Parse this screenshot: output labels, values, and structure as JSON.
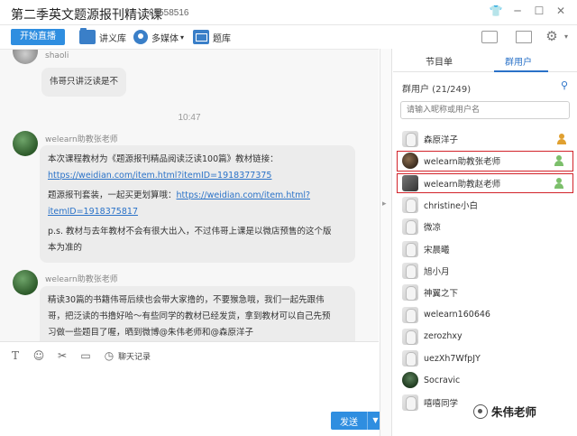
{
  "window": {
    "title": "第二季英文题源报刊精读课",
    "room_id": "81558516",
    "icons": {
      "skin": "shirt-icon",
      "minimize": "minimize-icon",
      "maximize": "maximize-icon",
      "close": "close-icon"
    }
  },
  "toolbar": {
    "live_label": "开始直播",
    "lectures_label": "讲义库",
    "media_label": "多媒体",
    "bank_label": "题库",
    "icons": [
      "briefcase-icon",
      "folder-icon",
      "settings-icon"
    ]
  },
  "chat": {
    "top_sender": "shaoli",
    "top_message": "伟哥只讲泛读是不",
    "timestamp": "10:47",
    "msg1": {
      "sender": "welearn助教张老师",
      "line1": "本次课程教材为《题源报刊精品阅读泛读100篇》教材链接：",
      "link1": "https://weidian.com/item.html?itemID=1918377375",
      "line2": "题源报刊套装，一起买更划算哦：",
      "link2a": "https://weidian.com/item.html?",
      "link2b": "itemID=1918375817",
      "line3": "p.s. 教材与去年教材不会有很大出入，不过伟哥上课是以微店预售的这个版",
      "line4": "本为准的"
    },
    "msg2": {
      "sender": "welearn助教张老师",
      "line1": "精读30篇的书籍伟哥后续也会带大家撸的，不要猴急哦，我们一起先跟伟",
      "line2": "哥，把泛读的书撸好哈～有些同学的教材已经发货，拿到教材可以自己先预",
      "line3": "习做一些题目了喔，晒到微博@朱伟老师和@森原洋子"
    }
  },
  "input": {
    "history_label": "聊天记录",
    "send_label": "发送"
  },
  "panel": {
    "tab_program": "节目单",
    "tab_users": "群用户",
    "count_label": "群用户 (21/249)",
    "search_placeholder": "请输入昵称或用户名",
    "users": [
      {
        "name": "森原洋子",
        "badge": "gold"
      },
      {
        "name": "welearn助教张老师",
        "badge": "green"
      },
      {
        "name": "welearn助教赵老师",
        "badge": "green"
      },
      {
        "name": "christine小白",
        "badge": ""
      },
      {
        "name": "微凉",
        "badge": ""
      },
      {
        "name": "宋晨曦",
        "badge": ""
      },
      {
        "name": "旭小月",
        "badge": ""
      },
      {
        "name": "神翼之下",
        "badge": ""
      },
      {
        "name": "welearn160646",
        "badge": ""
      },
      {
        "name": "zerozhxy",
        "badge": ""
      },
      {
        "name": "uezXh7WfpJY",
        "badge": ""
      },
      {
        "name": "Socravic",
        "badge": ""
      },
      {
        "name": "嘻嘻同学",
        "badge": ""
      }
    ]
  },
  "watermark": "朱伟老师"
}
